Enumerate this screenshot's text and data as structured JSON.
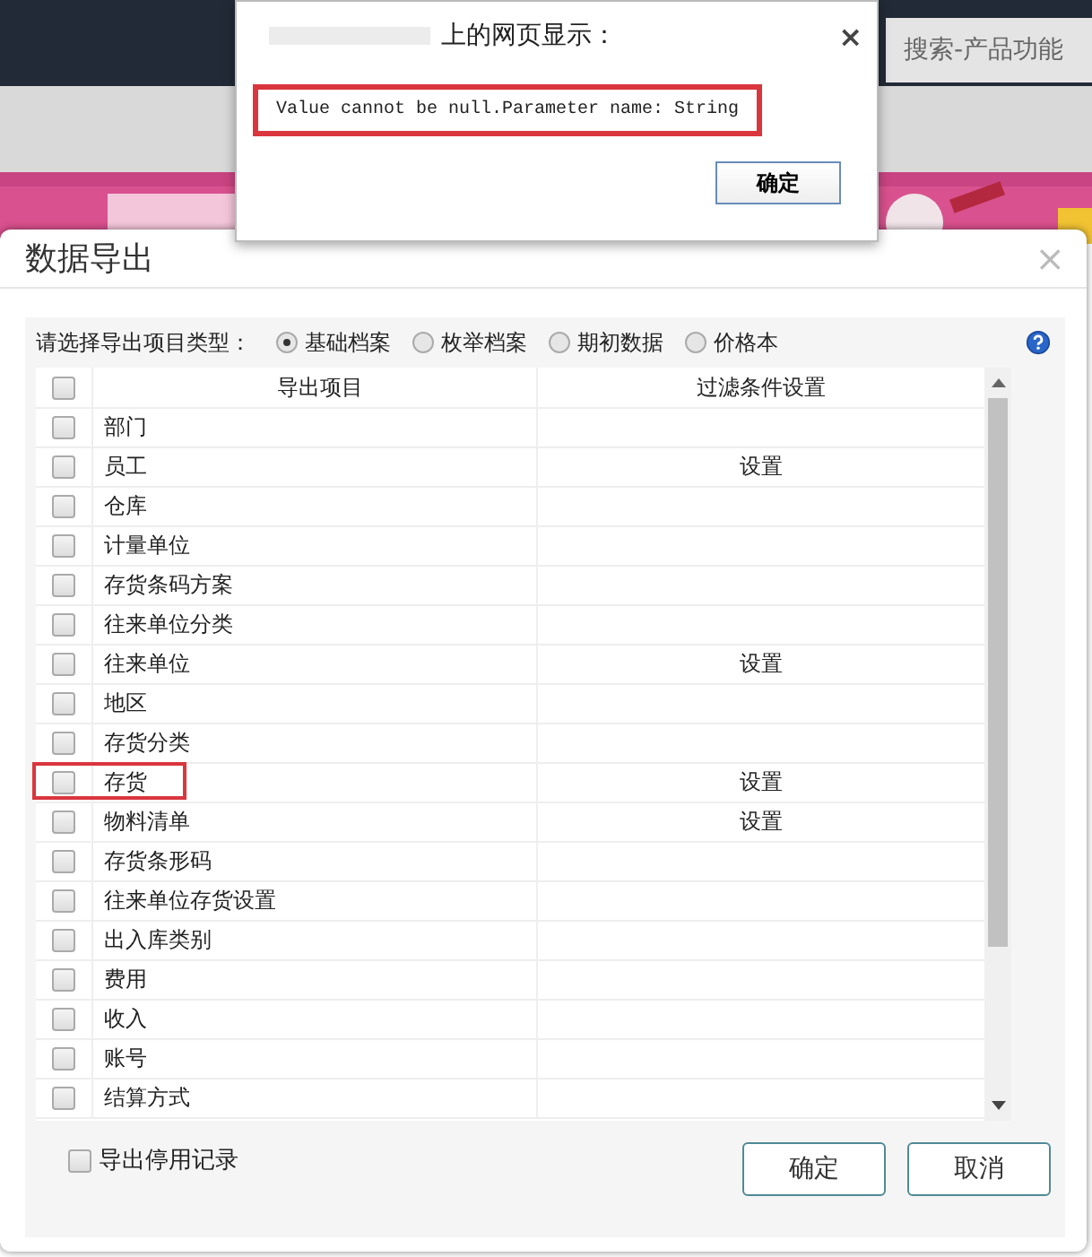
{
  "page": {
    "search_link": "搜索-产品功能"
  },
  "alert": {
    "title": "上的网页显示：",
    "message": "Value cannot be null.Parameter name: String",
    "message_highlighted": true,
    "close": "×",
    "button": "确定"
  },
  "dialog": {
    "title": "数据导出",
    "close": "×",
    "type_label": "请选择导出项目类型：",
    "types": [
      {
        "label": "基础档案",
        "selected": true
      },
      {
        "label": "枚举档案",
        "selected": false
      },
      {
        "label": "期初数据",
        "selected": false
      },
      {
        "label": "价格本",
        "selected": false
      }
    ],
    "table": {
      "columns": [
        "导出项目",
        "过滤条件设置"
      ],
      "header_checked": false,
      "rows": [
        {
          "name": "部门",
          "filter": "",
          "checked": false,
          "highlighted": false
        },
        {
          "name": "员工",
          "filter": "设置",
          "checked": false,
          "highlighted": false
        },
        {
          "name": "仓库",
          "filter": "",
          "checked": false,
          "highlighted": false
        },
        {
          "name": "计量单位",
          "filter": "",
          "checked": false,
          "highlighted": false
        },
        {
          "name": "存货条码方案",
          "filter": "",
          "checked": false,
          "highlighted": false
        },
        {
          "name": "往来单位分类",
          "filter": "",
          "checked": false,
          "highlighted": false
        },
        {
          "name": "往来单位",
          "filter": "设置",
          "checked": false,
          "highlighted": false
        },
        {
          "name": "地区",
          "filter": "",
          "checked": false,
          "highlighted": false
        },
        {
          "name": "存货分类",
          "filter": "",
          "checked": false,
          "highlighted": false
        },
        {
          "name": "存货",
          "filter": "设置",
          "checked": false,
          "highlighted": true
        },
        {
          "name": "物料清单",
          "filter": "设置",
          "checked": false,
          "highlighted": false
        },
        {
          "name": "存货条形码",
          "filter": "",
          "checked": false,
          "highlighted": false
        },
        {
          "name": "往来单位存货设置",
          "filter": "",
          "checked": false,
          "highlighted": false
        },
        {
          "name": "出入库类别",
          "filter": "",
          "checked": false,
          "highlighted": false
        },
        {
          "name": "费用",
          "filter": "",
          "checked": false,
          "highlighted": false
        },
        {
          "name": "收入",
          "filter": "",
          "checked": false,
          "highlighted": false
        },
        {
          "name": "账号",
          "filter": "",
          "checked": false,
          "highlighted": false
        },
        {
          "name": "结算方式",
          "filter": "",
          "checked": false,
          "highlighted": false
        }
      ]
    },
    "include_disabled": {
      "label": "导出停用记录",
      "checked": false
    },
    "buttons": [
      "确定",
      "取消"
    ]
  }
}
